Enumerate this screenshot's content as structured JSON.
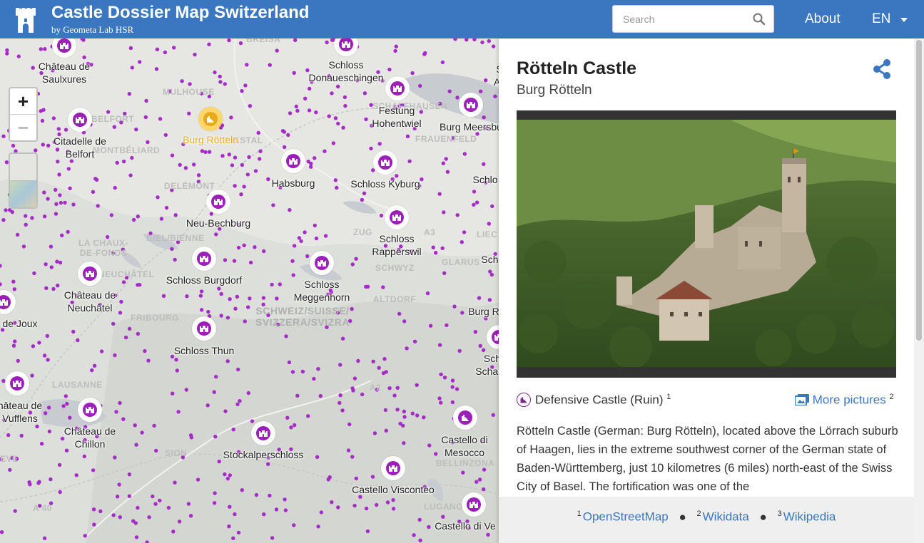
{
  "header": {
    "title": "Castle Dossier Map Switzerland",
    "subtitle": "by Geometa Lab HSR",
    "search_placeholder": "Search",
    "nav_about": "About",
    "nav_lang": "EN"
  },
  "map": {
    "zoom_in": "+",
    "zoom_out": "−",
    "selected_label": "Burg Rötteln",
    "castles": [
      {
        "name": "castle-chateau-de-saulxures",
        "label": "Château de\nSaulxures"
      },
      {
        "name": "castle-schloss-donaueschingen",
        "label": "Schloss\nDonaueschingen"
      },
      {
        "name": "castle-festung-hohentwiel",
        "label": "Festung\nHohentwiel"
      },
      {
        "name": "castle-burg-meersburg",
        "label": "Burg Meersbu"
      },
      {
        "name": "castle-citadelle-de-belfort",
        "label": "Citadelle de\nBelfort"
      },
      {
        "name": "castle-habsburg",
        "label": "Habsburg"
      },
      {
        "name": "castle-schloss-kyburg",
        "label": "Schloss Kyburg"
      },
      {
        "name": "castle-neu-bechburg",
        "label": "Neu-Bechburg"
      },
      {
        "name": "castle-schloss-rapperswil",
        "label": "Schloss\nRapperswil"
      },
      {
        "name": "castle-schloss-burgdorf",
        "label": "Schloss Burgdorf"
      },
      {
        "name": "castle-schloss-meggenhorn",
        "label": "Schloss\nMeggenhorn"
      },
      {
        "name": "castle-chateau-de-neuchatel",
        "label": "Château de\nNeuchâtel"
      },
      {
        "name": "castle-chateau-de-joux",
        "label": "de Joux"
      },
      {
        "name": "castle-schloss-thun",
        "label": "Schloss Thun"
      },
      {
        "name": "castle-chateau-de-vufflens",
        "label": "hâteau de\nVufflens"
      },
      {
        "name": "castle-chateau-de-chillon",
        "label": "Château de\nChillon"
      },
      {
        "name": "castle-stockalperschloss",
        "label": "Stockalperschloss"
      },
      {
        "name": "castle-castello-di-mesocco",
        "label": "Castello di\nMesocco"
      },
      {
        "name": "castle-castello-visconteo",
        "label": "Castello Visconteo"
      },
      {
        "name": "castle-castello-di-ve",
        "label": "Castello di Ve"
      },
      {
        "name": "castle-schlo-right-1",
        "label": "Schlo"
      },
      {
        "name": "castle-schl-right-2",
        "label": "Schl"
      },
      {
        "name": "castle-burg-r-right",
        "label": "Burg R"
      },
      {
        "name": "castle-schaue-right",
        "label": "Sch\nSchaue"
      },
      {
        "name": "castle-s-alt-right",
        "label": "S\nAlt"
      }
    ],
    "places": [
      "BREISA",
      "MULHOUSE",
      "BELFORT",
      "MONTBÉLIARD",
      "DELÉMONT",
      "LIESTAL",
      "SCHAFFHAUSEN",
      "FRAUENFELD",
      "LA CHAUX-\nDE-FONDS",
      "BIEL/BIENNE",
      "NEUCHÂTEL",
      "FRIBOURG",
      "LAUSANNE",
      "ZUG",
      "SCHWYZ",
      "GLARUS",
      "ALTDORF",
      "LIEC",
      "BELLINZONA",
      "LUGANO",
      "SION",
      "EVE",
      "A 40",
      "A2",
      "A3",
      "SCHWEIZ/SUISSE/\nSVIZZERA/SVIZRA"
    ]
  },
  "panel": {
    "title": "Rötteln Castle",
    "subtitle": "Burg Rötteln",
    "castle_type": "Defensive Castle (Ruin)",
    "castle_type_ref": "1",
    "more_pictures": "More pictures",
    "more_pictures_ref": "2",
    "description": "Rötteln Castle (German: Burg Rötteln), located above the Lörrach suburb of Haagen, lies in the extreme southwest corner of the German state of Baden-Württemberg, just 10 kilometres (6 miles) north-east of the Swiss City of Basel. The fortification was one of the",
    "footer": [
      {
        "num": "1",
        "label": "OpenStreetMap"
      },
      {
        "num": "2",
        "label": "Wikidata"
      },
      {
        "num": "3",
        "label": "Wikipedia"
      }
    ],
    "footer_sep": "●"
  },
  "colors": {
    "header": "#3a77c0",
    "marker": "#9b1fb8",
    "selected": "#f5c242",
    "link": "#3a77c0"
  }
}
